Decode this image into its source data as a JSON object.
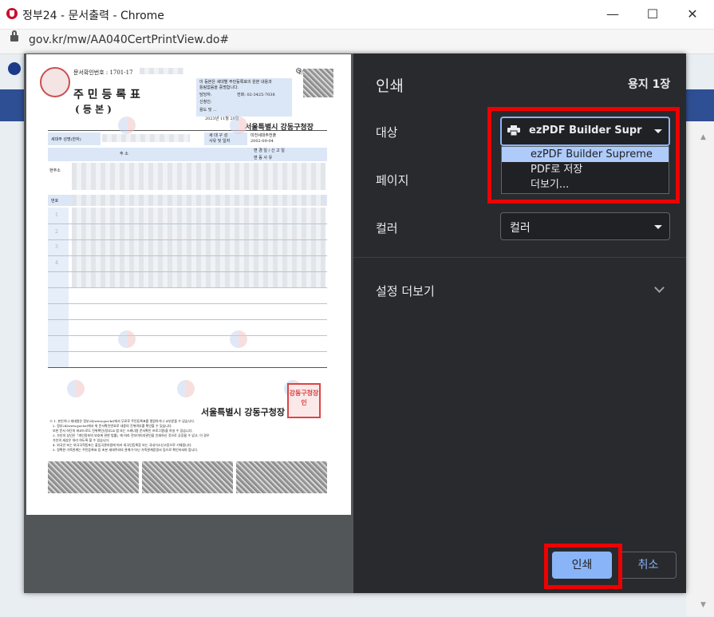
{
  "window": {
    "title": "정부24 - 문서출력 - Chrome",
    "url": "gov.kr/mw/AA040CertPrintView.do#",
    "controls": {
      "minimize": "—",
      "maximize": "☐",
      "close": "✕"
    }
  },
  "print_dialog": {
    "title": "인쇄",
    "sheet_count": "용지 1장",
    "destination": {
      "label": "대상",
      "value": "ezPDF Builder Supreme",
      "options": [
        "ezPDF Builder Supreme",
        "PDF로 저장",
        "더보기..."
      ]
    },
    "pages": {
      "label": "페이지"
    },
    "color": {
      "label": "컬러",
      "value": "컬러"
    },
    "more_settings": "설정 더보기",
    "print_button": "인쇄",
    "cancel_button": "취소",
    "accent_color": "#8ab4f8",
    "highlight_color": "#e00000"
  },
  "document": {
    "doc_number": "문서확인번호 : 1701-17",
    "page_num": "1/1",
    "title": "주 민 등 록 표",
    "subtitle": "( 등          본 )",
    "header_note_1": "이 등본은 세대별 주민등록표의 원본 내용과",
    "header_note_2": "틀림없음을 증명합니다.",
    "field_officer": "담당자:",
    "field_phone": "전화: 02-3425-7038",
    "field_applicant": "신청인:",
    "field_purpose": "용도 및 ...",
    "issue_date": "2023년 11월 28일",
    "issuer": "서울특별시 강동구청장",
    "col_householder": "세대주 성명(한자)",
    "col_reason": "세 대 구 성\n사유 및 일자",
    "reason_value": "미전세대주전출",
    "reason_date": "2002-09-04",
    "col_address": "주                    소",
    "col_change": "변 경 일 / 신 고 일",
    "col_change2": "변 동 사 유",
    "row_current": "현주소",
    "row_number": "번호",
    "row_items": [
      "1",
      "2",
      "3",
      "4"
    ],
    "footer_issuer": "서울특별시 강동구청장",
    "seal_text": "강동구청장인",
    "notes": [
      "※ 1. 본인이나 세대원은 정부24(www.gov.kr)에서 무료로 주민등록표를 열람하거나 교부받을 수 있습니다.",
      "2. 정부24(www.gov.kr)에서 위 문서확인번호로 내용의 진위여부를 확인할 수 있습니다.",
      "또한 문서 하단의 바코드로도 진위확인(정부24 앱 또는 스캐너용 문서확인 프로그램)을 하실 수 있습니다.",
      "3. 가인의 성인은「개인정보의 보호에 관한 법률」에 따라 전자이미지관인을 인쇄하신 것으로 공증될 수 있고, 이 경우",
      "가인의 세상은 처리 하도록 할 수 있습니다.",
      "4. 외국인 또는 외국국적동포는 출입국관리법에 따라 외국인등록증 또는 국내거소신고증으로 기재됩니다.",
      "5. 정확한 가족관계는 주민등록표 등·초본 세대주와의 관계가 아닌 가족관계증명서 등으로 확인하셔야 합니다."
    ]
  }
}
